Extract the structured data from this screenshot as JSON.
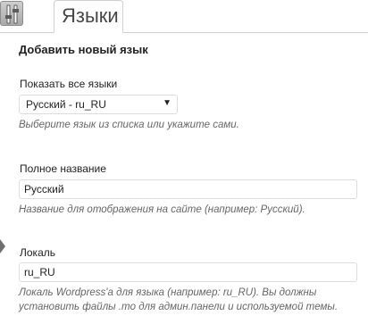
{
  "header": {
    "icon": "settings-sliders-icon",
    "tab_label": "Языки"
  },
  "form": {
    "section_title": "Добавить новый язык",
    "show_all": {
      "label": "Показать все языки",
      "selected": "Русский - ru_RU",
      "arrow": "▼",
      "hint": "Выберите язык из списка или укажите сами."
    },
    "full_name": {
      "label": "Полное название",
      "value": "Русский",
      "hint": "Название для отображения на сайте (например: Русский)."
    },
    "locale": {
      "label": "Локаль",
      "value": "ru_RU",
      "hint_line1": "Локаль Wordpress'a для языка (например: ru_RU). Вы должны",
      "hint_line2": "установить файлы .mo для админ.панели и используемой темы."
    }
  },
  "colors": {
    "border": "#cfcfcf",
    "hint_text": "#666666",
    "label_text": "#222222"
  }
}
